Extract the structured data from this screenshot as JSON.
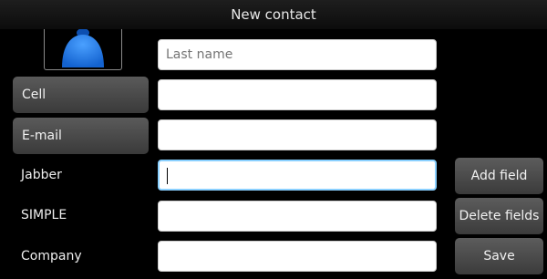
{
  "window": {
    "title": "New contact"
  },
  "avatar": {
    "icon": "contact-avatar-icon",
    "color": "#1f78e6"
  },
  "fields": {
    "last_name": {
      "placeholder": "Last name",
      "value": ""
    },
    "cell": {
      "label": "Cell",
      "value": ""
    },
    "email": {
      "label": "E-mail",
      "value": ""
    },
    "jabber": {
      "label": "Jabber",
      "value": ""
    },
    "simple": {
      "label": "SIMPLE",
      "value": ""
    },
    "company": {
      "label": "Company",
      "value": ""
    }
  },
  "actions": {
    "add_field": "Add field",
    "delete_fields": "Delete fields",
    "save": "Save"
  },
  "colors": {
    "focus_border": "#8ad0ff",
    "background": "#000000"
  }
}
